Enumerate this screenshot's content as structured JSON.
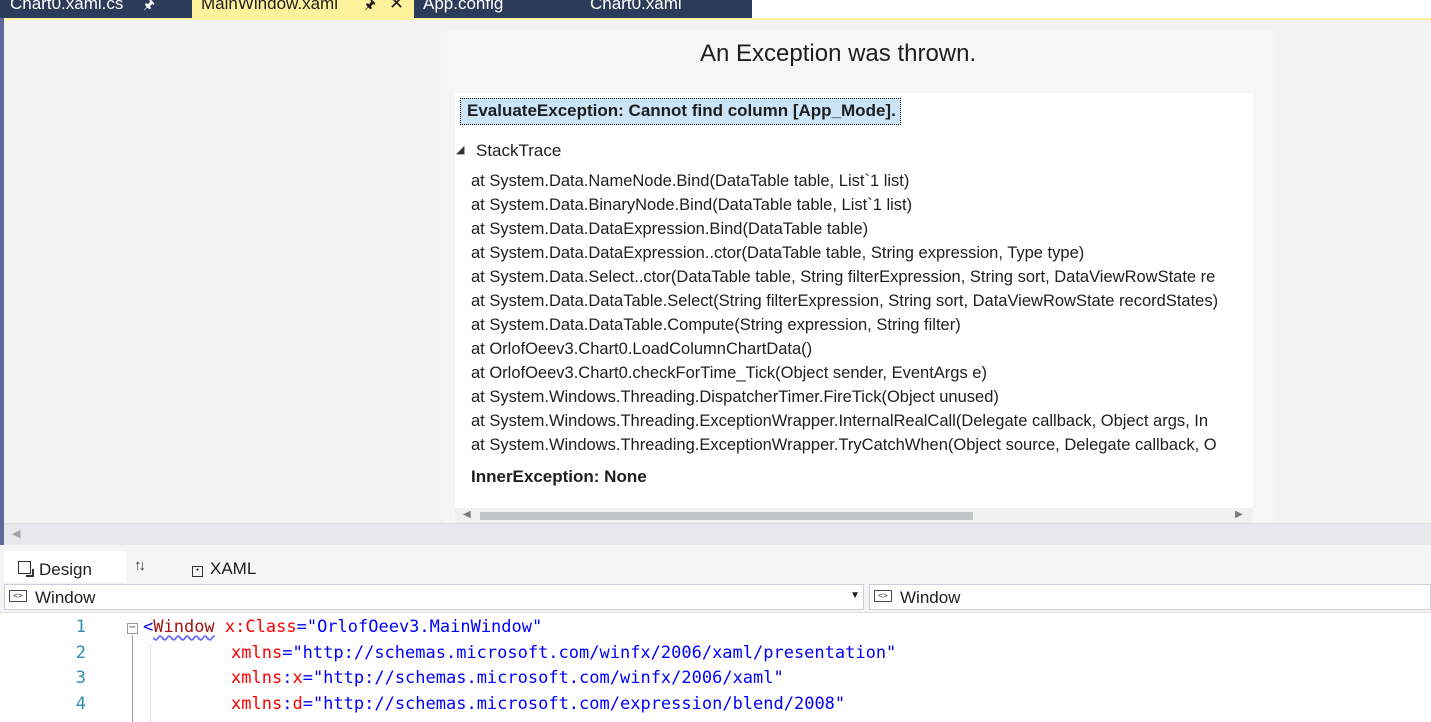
{
  "tabs": [
    {
      "label": "Chart0.xaml.cs",
      "pinned": true,
      "active": false
    },
    {
      "label": "MainWindow.xaml",
      "pinned": true,
      "active": true,
      "closable": true
    },
    {
      "label": "App.config",
      "active": false
    },
    {
      "label": "Chart0.xaml",
      "active": false
    }
  ],
  "designer": {
    "error_title": "An Exception was thrown.",
    "exception_message": "EvaluateException: Cannot find column [App_Mode].",
    "stack_trace_header": "StackTrace",
    "stack_trace": [
      "at System.Data.NameNode.Bind(DataTable table, List`1 list)",
      "at System.Data.BinaryNode.Bind(DataTable table, List`1 list)",
      "at System.Data.DataExpression.Bind(DataTable table)",
      "at System.Data.DataExpression..ctor(DataTable table, String expression, Type type)",
      "at System.Data.Select..ctor(DataTable table, String filterExpression, String sort, DataViewRowState re",
      "at System.Data.DataTable.Select(String filterExpression, String sort, DataViewRowState recordStates)",
      "at System.Data.DataTable.Compute(String expression, String filter)",
      "at OrlofOeev3.Chart0.LoadColumnChartData()",
      "at OrlofOeev3.Chart0.checkForTime_Tick(Object sender, EventArgs e)",
      "at System.Windows.Threading.DispatcherTimer.FireTick(Object unused)",
      "at System.Windows.Threading.ExceptionWrapper.InternalRealCall(Delegate callback, Object args, In",
      "at System.Windows.Threading.ExceptionWrapper.TryCatchWhen(Object source, Delegate callback, O"
    ],
    "inner_exception": "InnerException: None"
  },
  "view_switcher": {
    "design_label": "Design",
    "xaml_label": "XAML"
  },
  "navigation": {
    "type_combo": "Window",
    "member_combo": "Window"
  },
  "editor": {
    "lines": [
      {
        "number": "1",
        "tokens": [
          {
            "text": "<",
            "kind": "punc"
          },
          {
            "text": "Window",
            "kind": "elem"
          },
          {
            "text": " ",
            "kind": "plain"
          },
          {
            "text": "x:Class",
            "kind": "attr"
          },
          {
            "text": "=",
            "kind": "punc"
          },
          {
            "text": "\"OrlofOeev3.MainWindow\"",
            "kind": "val"
          }
        ]
      },
      {
        "number": "2",
        "tokens": [
          {
            "text": "xmlns",
            "kind": "attr"
          },
          {
            "text": "=",
            "kind": "punc"
          },
          {
            "text": "\"http://schemas.microsoft.com/winfx/2006/xaml/presentation\"",
            "kind": "val"
          }
        ]
      },
      {
        "number": "3",
        "tokens": [
          {
            "text": "xmlns",
            "kind": "attr"
          },
          {
            "text": ":",
            "kind": "punc"
          },
          {
            "text": "x",
            "kind": "attr"
          },
          {
            "text": "=",
            "kind": "punc"
          },
          {
            "text": "\"http://schemas.microsoft.com/winfx/2006/xaml\"",
            "kind": "val"
          }
        ]
      },
      {
        "number": "4",
        "tokens": [
          {
            "text": "xmlns",
            "kind": "attr"
          },
          {
            "text": ":",
            "kind": "punc"
          },
          {
            "text": "d",
            "kind": "attr"
          },
          {
            "text": "=",
            "kind": "punc"
          },
          {
            "text": "\"http://schemas.microsoft.com/expression/blend/2008\"",
            "kind": "val"
          }
        ]
      }
    ]
  },
  "colors": {
    "tab_strip": "#2d3b5a",
    "active_tab": "#fff29d",
    "selection": "#cce4f7",
    "line_number": "#2b91af",
    "xml_element": "#a31515",
    "xml_attribute": "#ff0000",
    "xml_value": "#0000ff"
  },
  "icons": [
    "pin-icon",
    "close-icon",
    "collapse-triangle-icon",
    "design-view-icon",
    "swap-panes-icon",
    "xaml-view-icon",
    "element-icon",
    "dropdown-arrow-icon",
    "fold-toggle-icon"
  ]
}
